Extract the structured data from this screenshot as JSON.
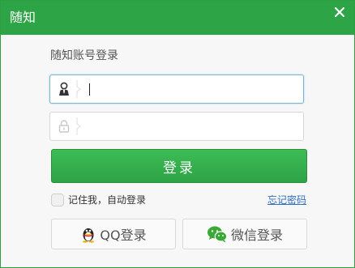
{
  "window": {
    "title": "随知"
  },
  "login": {
    "subtitle": "随知账号登录",
    "username_value": "",
    "password_value": "",
    "submit_label": "登录",
    "remember_label": "记住我，自动登录",
    "forgot_label": "忘记密码"
  },
  "social": {
    "qq_label": "QQ登录",
    "wechat_label": "微信登录"
  },
  "colors": {
    "titlebar": "#2da445",
    "button": "#34b04e",
    "link": "#2f6fbf"
  },
  "icons": [
    "close-icon",
    "user-icon",
    "lock-icon",
    "qq-penguin-icon",
    "wechat-icon"
  ]
}
